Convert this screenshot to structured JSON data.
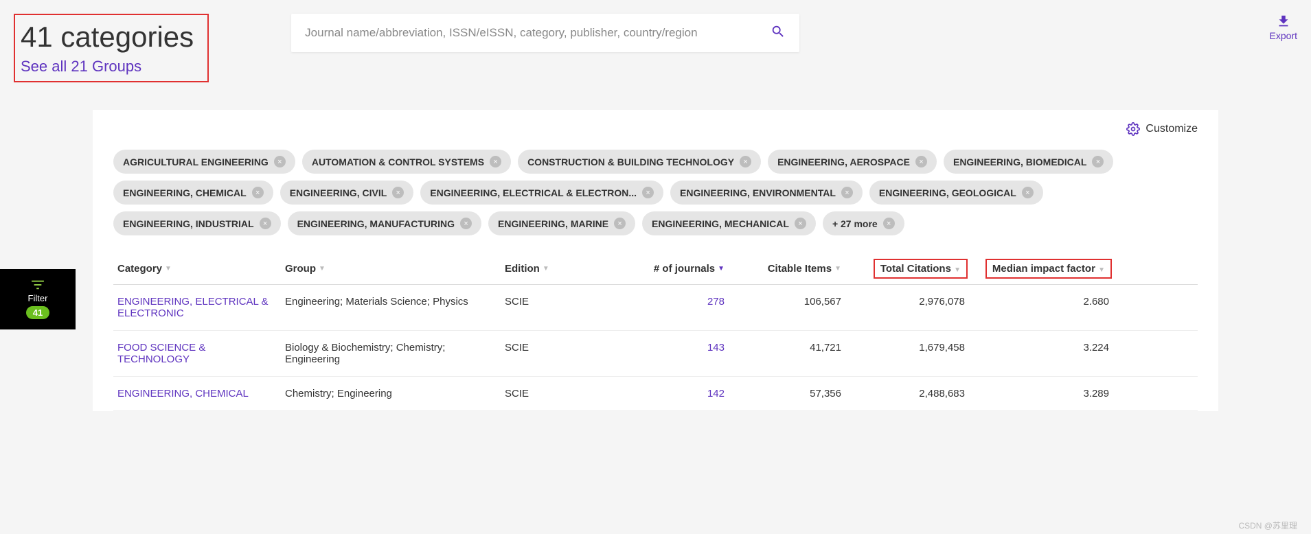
{
  "header": {
    "title": "41 categories",
    "see_all": "See all 21 Groups",
    "search_placeholder": "Journal name/abbreviation, ISSN/eISSN, category, publisher, country/region",
    "export_label": "Export"
  },
  "customize_label": "Customize",
  "filter": {
    "label": "Filter",
    "count": "41"
  },
  "chips": [
    "AGRICULTURAL ENGINEERING",
    "AUTOMATION & CONTROL SYSTEMS",
    "CONSTRUCTION & BUILDING TECHNOLOGY",
    "ENGINEERING, AEROSPACE",
    "ENGINEERING, BIOMEDICAL",
    "ENGINEERING, CHEMICAL",
    "ENGINEERING, CIVIL",
    "ENGINEERING, ELECTRICAL & ELECTRON...",
    "ENGINEERING, ENVIRONMENTAL",
    "ENGINEERING, GEOLOGICAL",
    "ENGINEERING, INDUSTRIAL",
    "ENGINEERING, MANUFACTURING",
    "ENGINEERING, MARINE",
    "ENGINEERING, MECHANICAL"
  ],
  "chips_more": "+ 27 more",
  "columns": {
    "category": "Category",
    "group": "Group",
    "edition": "Edition",
    "journals": "# of journals",
    "citable": "Citable Items",
    "total": "Total Citations",
    "median": "Median impact factor"
  },
  "rows": [
    {
      "category": "ENGINEERING, ELECTRICAL & ELECTRONIC",
      "group": "Engineering; Materials Science; Physics",
      "edition": "SCIE",
      "journals": "278",
      "citable": "106,567",
      "total": "2,976,078",
      "median": "2.680"
    },
    {
      "category": "FOOD SCIENCE & TECHNOLOGY",
      "group": "Biology & Biochemistry; Chemistry; Engineering",
      "edition": "SCIE",
      "journals": "143",
      "citable": "41,721",
      "total": "1,679,458",
      "median": "3.224"
    },
    {
      "category": "ENGINEERING, CHEMICAL",
      "group": "Chemistry; Engineering",
      "edition": "SCIE",
      "journals": "142",
      "citable": "57,356",
      "total": "2,488,683",
      "median": "3.289"
    }
  ],
  "watermark": "CSDN @苏里理"
}
